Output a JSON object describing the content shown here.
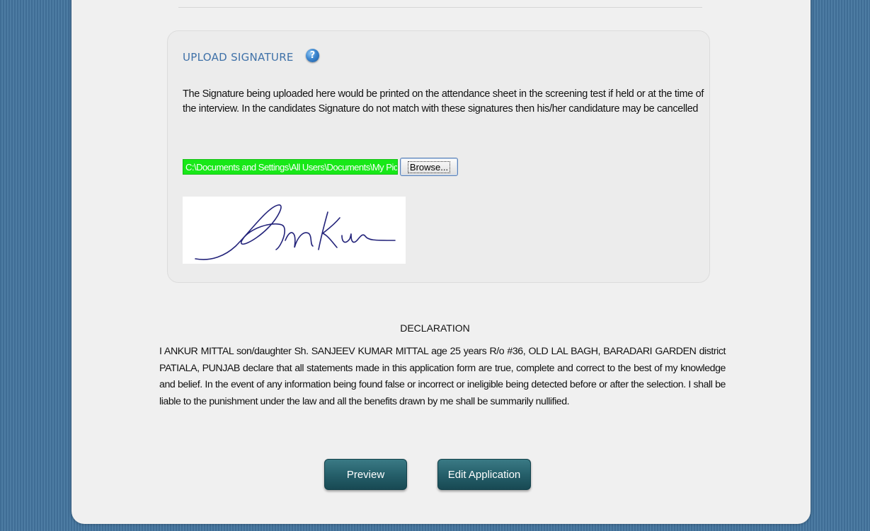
{
  "signature_section": {
    "title": "UPLOAD SIGNATURE",
    "help_icon": "help-icon",
    "description": "The Signature being uploaded here would be printed on the attendance sheet in the screening test if held or at the time of the interview. In the candidates Signature do not match with these signatures then his/her candidature may be cancelled",
    "file_value": "C:\\Documents and Settings\\All Users\\Documents\\My Pictures\\sign.jpg",
    "browse_label": "Browse...",
    "signature_text": "AnKur"
  },
  "declaration": {
    "title": "DECLARATION",
    "text": "I ANKUR MITTAL  son/daughter Sh. SANJEEV KUMAR MITTAL age 25  years R/o #36, OLD LAL BAGH, BARADARI GARDEN  district PATIALA, PUNJAB  declare that all statements made in this application form are true, complete and correct to the best of my knowledge and belief. In the event of any information being found false or incorrect or ineligible being detected before or after the selection. I shall be liable to the punishment under the law and all the benefits drawn by me shall be summarily nullified."
  },
  "actions": {
    "preview_label": "Preview",
    "edit_label": "Edit Application"
  },
  "colors": {
    "background": "#4a7aa2",
    "panel": "#f0f0f0",
    "title_blue": "#3f71a8",
    "file_input_bg": "#18e818",
    "button_teal": "#245d68"
  }
}
